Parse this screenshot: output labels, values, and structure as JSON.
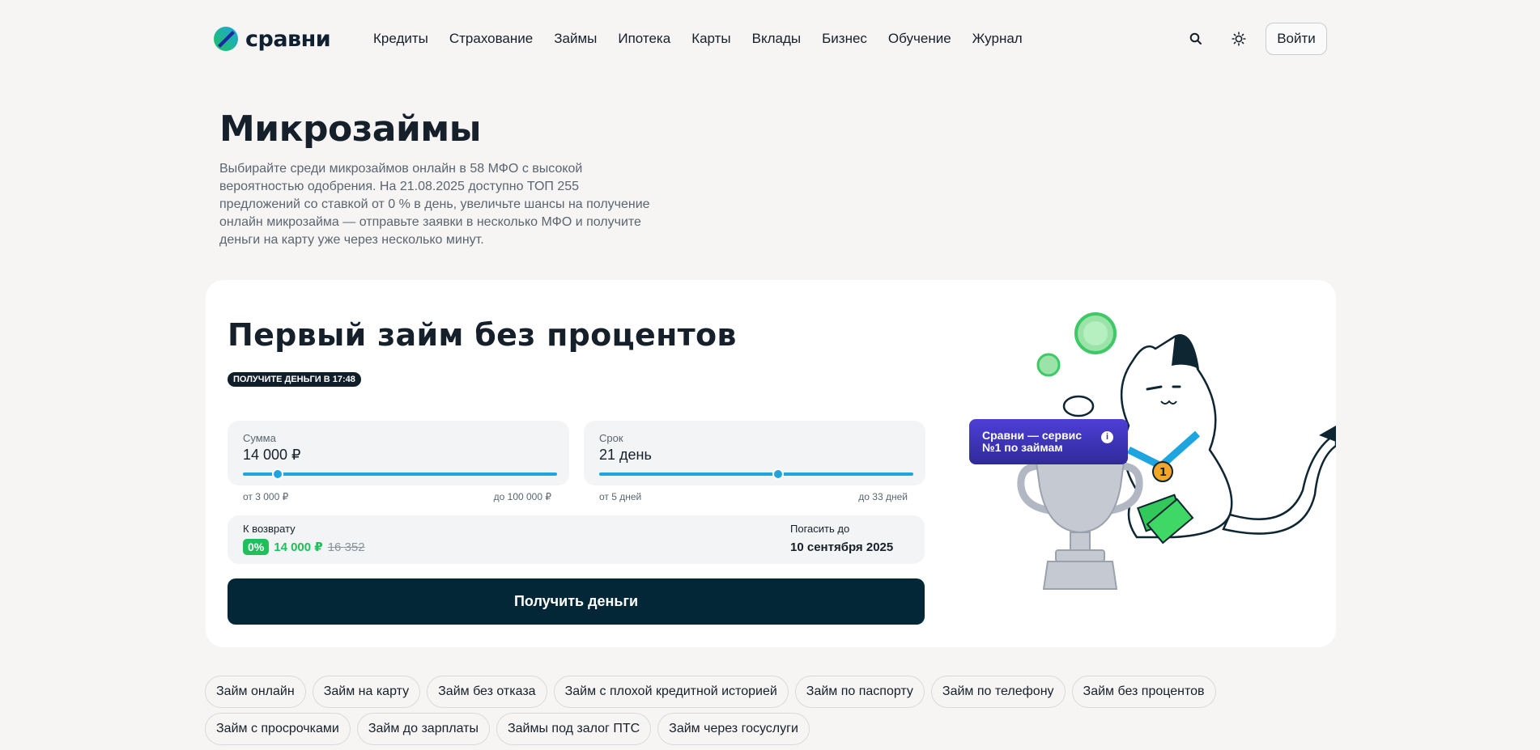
{
  "brand": {
    "name": "сравни"
  },
  "nav": {
    "items": [
      "Кредиты",
      "Страхование",
      "Займы",
      "Ипотека",
      "Карты",
      "Вклады",
      "Бизнес",
      "Обучение",
      "Журнал"
    ]
  },
  "header": {
    "login_label": "Войти"
  },
  "intro": {
    "title": "Микрозаймы",
    "description": "Выбирайте среди микрозаймов онлайн в 58 МФО с высокой вероятностью одобрения. На 21.08.2025 доступно ТОП 255 предложений со ставкой от 0 % в день, увеличьте шансы на получение онлайн микрозайма — отправьте заявки в несколько МФО и получите деньги на карту уже через несколько минут."
  },
  "promo": {
    "title": "Первый займ без процентов",
    "timer_badge": "ПОЛУЧИТЕ ДЕНЬГИ В 17:48",
    "amount": {
      "label": "Сумма",
      "value": "14 000 ₽",
      "min": "от 3 000 ₽",
      "max": "до 100 000 ₽",
      "fraction": 0.11
    },
    "term": {
      "label": "Срок",
      "value": "21 день",
      "min": "от 5 дней",
      "max": "до 33 дней",
      "fraction": 0.57
    },
    "return": {
      "label": "К возврату",
      "rate": "0%",
      "amount": "14 000 ₽",
      "old_amount": "16 352"
    },
    "due": {
      "label": "Погасить до",
      "date": "10 сентября 2025"
    },
    "cta_label": "Получить деньги",
    "badge_text_1": "Сравни — сервис",
    "badge_text_2": "№1 по займам",
    "badge_info": "i"
  },
  "tags": {
    "row1": [
      "Займ онлайн",
      "Займ на карту",
      "Займ без отказа",
      "Займ с плохой кредитной историей",
      "Займ по паспорту",
      "Займ по телефону",
      "Займ без процентов"
    ],
    "row2": [
      "Займ с просрочками",
      "Займ до зарплаты",
      "Займы под залог ПТС",
      "Займ через госуслуги"
    ]
  },
  "colors": {
    "accent": "#1ea4df",
    "cta": "#032736",
    "success": "#1fbf5c",
    "badge": "#3a33b8"
  }
}
